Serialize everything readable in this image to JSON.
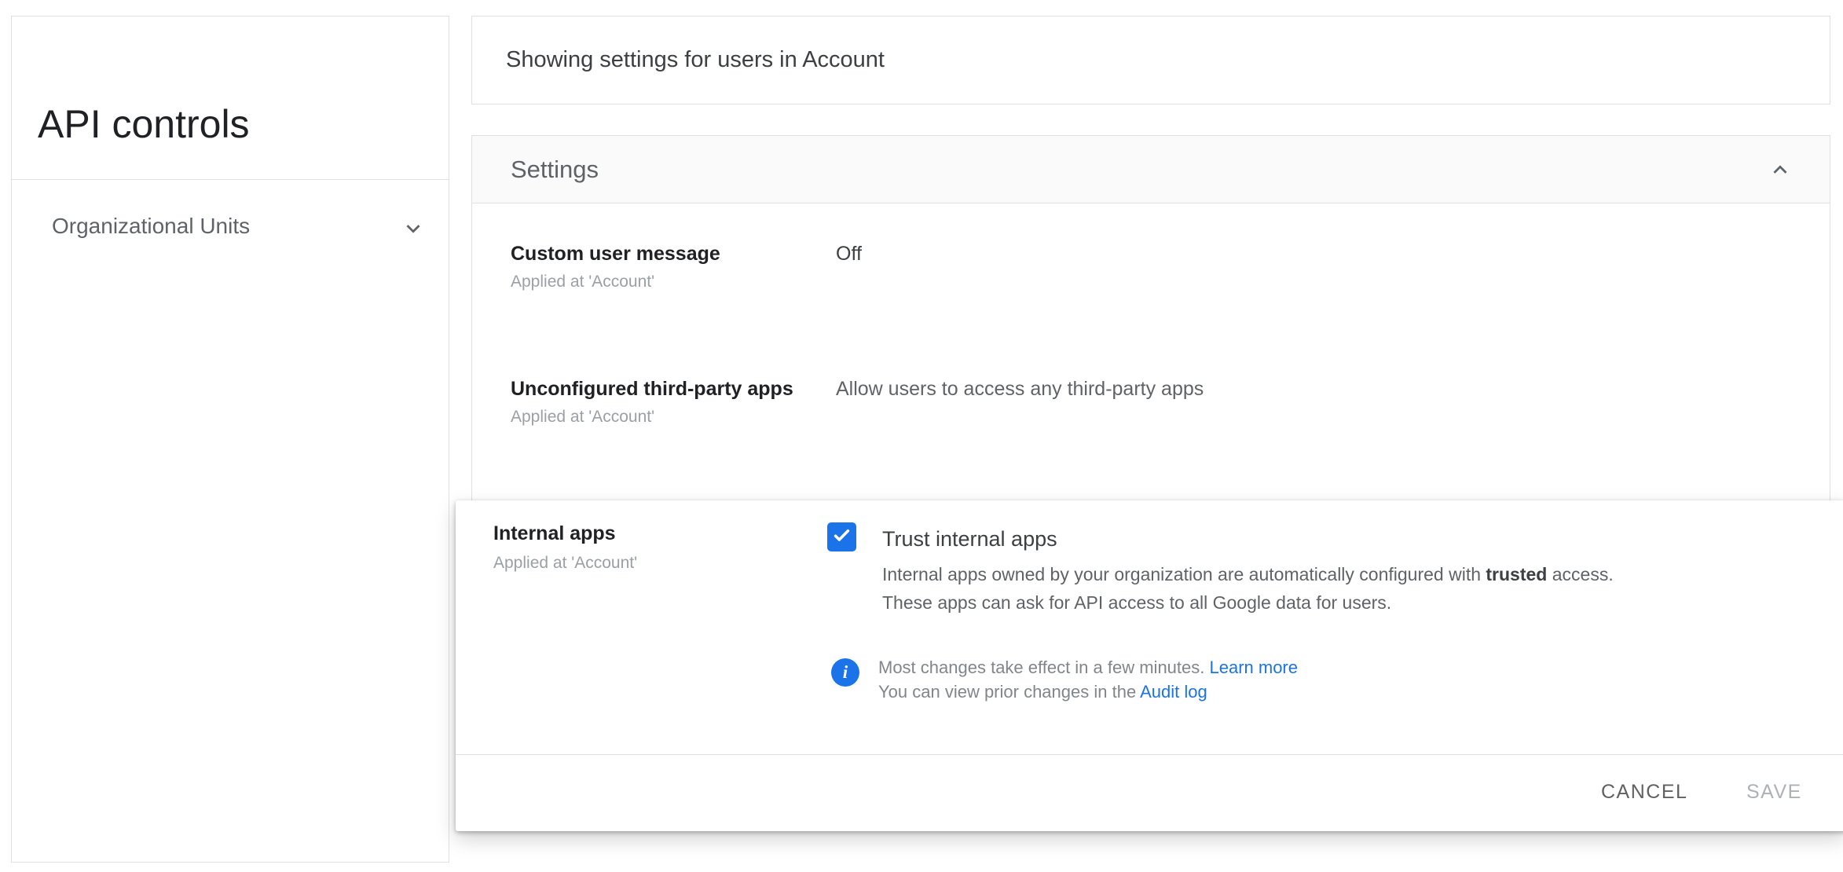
{
  "colors": {
    "accent_blue": "#1a73e8",
    "border_gray": "#e0e0e0",
    "header_bg": "#fafafa",
    "text_dark": "#202124",
    "text_gray": "#5f6368",
    "text_light_gray": "#9aa0a6"
  },
  "sidebar": {
    "title": "API controls",
    "org_units_label": "Organizational Units"
  },
  "topbar": {
    "text": "Showing settings for users in Account"
  },
  "settings": {
    "header": "Settings",
    "rows": [
      {
        "label": "Custom user message",
        "applied": "Applied at 'Account'",
        "value": "Off"
      },
      {
        "label": "Unconfigured third-party apps",
        "applied": "Applied at 'Account'",
        "value": "Allow users to access any third-party apps"
      }
    ]
  },
  "internal_apps": {
    "label": "Internal apps",
    "applied": "Applied at 'Account'",
    "checkbox_checked": true,
    "checkbox_label": "Trust internal apps",
    "desc_before": "Internal apps owned by your organization are automatically configured with ",
    "desc_bold": "trusted",
    "desc_after": " access.",
    "desc_line2": "These apps can ask for API access to all Google data for users.",
    "info_icon_glyph": "i",
    "info_line1": "Most changes take effect in a few minutes. ",
    "info_link1": "Learn more",
    "info_line2": "You can view prior changes in the ",
    "info_link2": "Audit log",
    "cancel_label": "CANCEL",
    "save_label": "SAVE"
  }
}
